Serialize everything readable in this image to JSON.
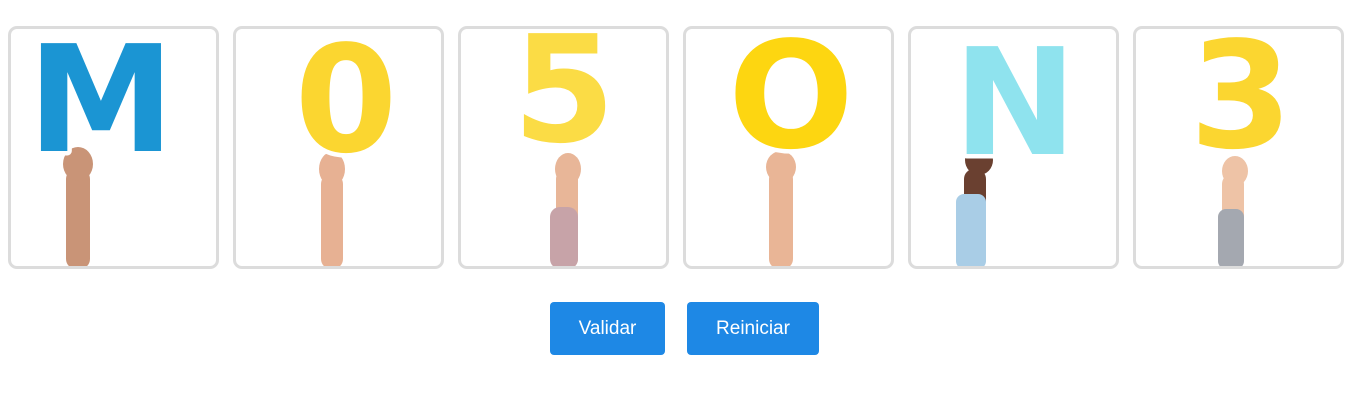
{
  "cards": [
    {
      "letter": "M",
      "letter_color": "#1b95d3",
      "skin": "#c99477",
      "sleeve": ""
    },
    {
      "letter": "0",
      "letter_color": "#fbd630",
      "skin": "#e7b193",
      "sleeve": ""
    },
    {
      "letter": "5",
      "letter_color": "#fbdc45",
      "skin": "#e8b698",
      "sleeve": "#c7a3a8"
    },
    {
      "letter": "O",
      "letter_color": "#fdd611",
      "skin": "#e9b596",
      "sleeve": ""
    },
    {
      "letter": "N",
      "letter_color": "#8fe3ee",
      "skin": "#6a4030",
      "sleeve": "#a9cde6"
    },
    {
      "letter": "3",
      "letter_color": "#fbd630",
      "skin": "#eec3a6",
      "sleeve": "#a4a8b0"
    }
  ],
  "buttons": {
    "validar": "Validar",
    "reiniciar": "Reiniciar"
  },
  "colors": {
    "button_bg": "#1e88e5",
    "card_border": "#dcdcdc"
  }
}
